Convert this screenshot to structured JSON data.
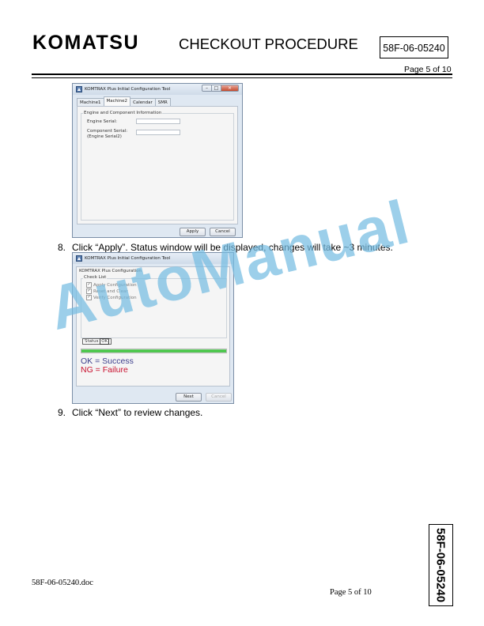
{
  "header": {
    "logo": "KOMATSU",
    "title": "CHECKOUT PROCEDURE",
    "doc_number": "58F-06-05240",
    "page": "Page 5 of 10"
  },
  "window1": {
    "title": "KOMTRAX Plus Initial Configuration Tool",
    "tabs": [
      "Machine1",
      "Machine2",
      "Calendar",
      "SMR"
    ],
    "active_tab": "Machine2",
    "group_title": "Engine and Component Information",
    "engine_serial_label": "Engine Serial:",
    "component_serial_label": "Component Serial:",
    "component_serial_sub": "(Engine Serial2)",
    "apply_button": "Apply",
    "cancel_button": "Cancel"
  },
  "step8": {
    "number": "8.",
    "text": "Click “Apply”. Status window will be displayed, changes will take ~3 minutes."
  },
  "window2": {
    "title": "KOMTRAX Plus Initial Configuration Tool",
    "subtitle": "KOMTRAX Plus Configuration",
    "checklist_title": "Check List",
    "checklist": [
      "Apply Configuration",
      "Reset and Clear",
      "Verify Configuration"
    ],
    "status_label": "Status",
    "status_value": "OK",
    "progress": 1.0,
    "legend_ok": "OK = Success",
    "legend_ng": "NG = Failure",
    "next_button": "Next",
    "cancel_button": "Cancel",
    "colors": {
      "ok_text": "#3c3e8c",
      "ng_text": "#c8102e",
      "progress": "#35c435"
    }
  },
  "step9": {
    "number": "9.",
    "text": "Click “Next” to review changes."
  },
  "watermark": "AutoManual",
  "footer": {
    "filename": "58F-06-05240.doc",
    "page": "Page 5 of 10",
    "side_label": "58F-06-05240"
  }
}
